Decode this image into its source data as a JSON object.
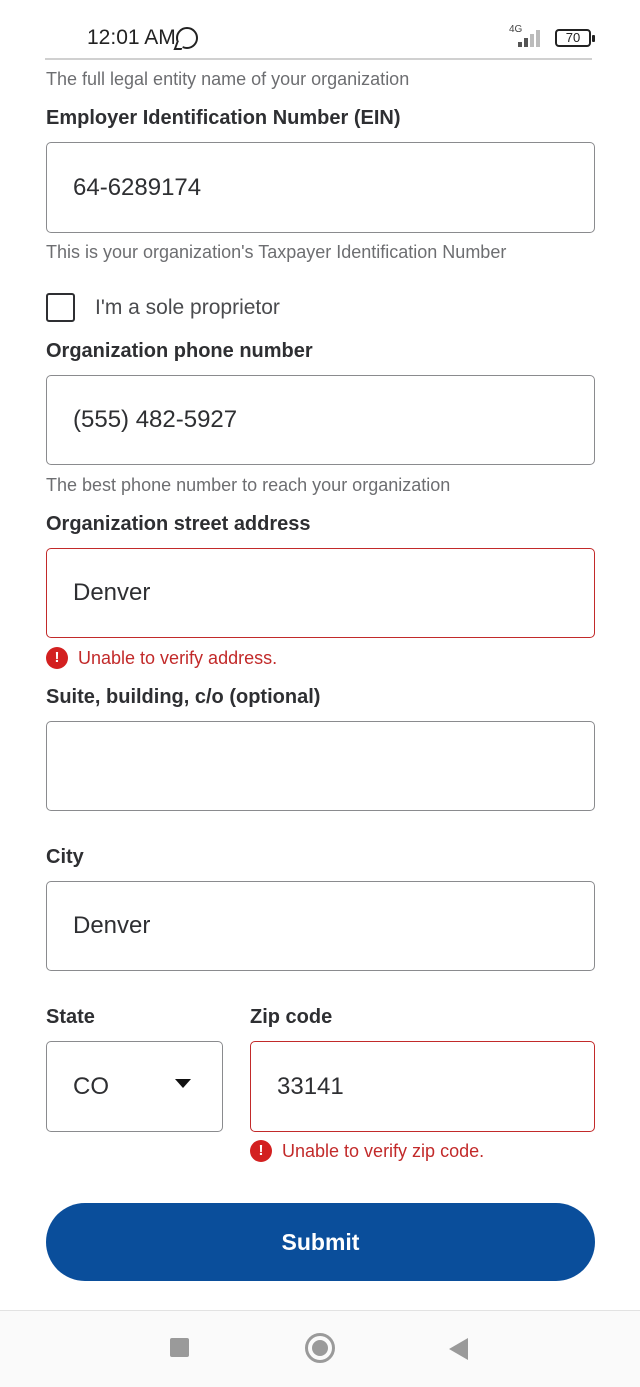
{
  "status_bar": {
    "time": "12:01 AM",
    "network": "4G",
    "battery": "70",
    "icons": [
      "whatsapp-icon",
      "signal-icon",
      "battery-icon"
    ]
  },
  "form": {
    "legal_name_helper": "The full legal entity name of your organization",
    "ein": {
      "label": "Employer Identification Number (EIN)",
      "value": "64-6289174",
      "helper": "This is your organization's Taxpayer Identification Number"
    },
    "sole_proprietor": {
      "label": "I'm a sole proprietor",
      "checked": false
    },
    "phone": {
      "label": "Organization phone number",
      "value": "(555) 482-5927",
      "helper": "The best phone number to reach your organization"
    },
    "street": {
      "label": "Organization street address",
      "value": "Denver",
      "error": "Unable to verify address."
    },
    "suite": {
      "label": "Suite, building, c/o (optional)",
      "value": ""
    },
    "city": {
      "label": "City",
      "value": "Denver"
    },
    "state": {
      "label": "State",
      "value": "CO"
    },
    "zip": {
      "label": "Zip code",
      "value": "33141",
      "error": "Unable to verify zip code."
    },
    "error_icon_glyph": "!",
    "submit_label": "Submit"
  },
  "colors": {
    "primary": "#0a4e9b",
    "error": "#c22a2a",
    "text": "#2e2f32",
    "helper": "#6d6e71"
  }
}
